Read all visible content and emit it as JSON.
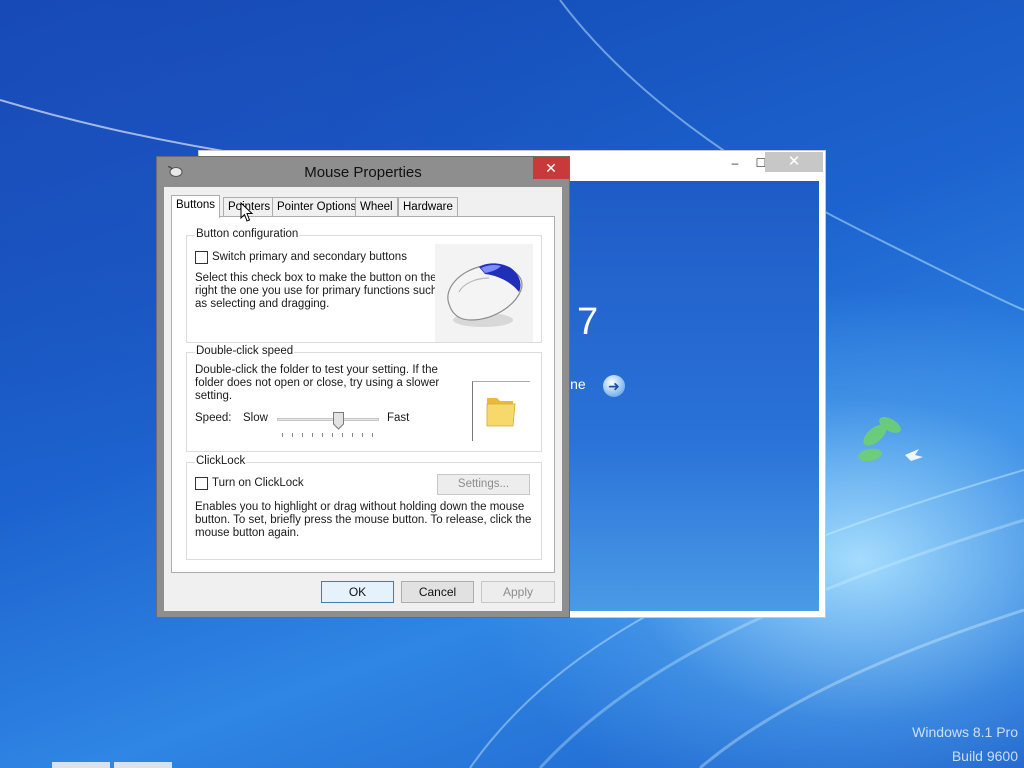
{
  "desktop": {
    "watermark_line1": "Windows 8.1 Pro",
    "watermark_line2": "Build 9600"
  },
  "background_window": {
    "minimize_glyph": "–",
    "maximize_glyph": "☐",
    "close_glyph": "✕",
    "partial_heading": "7",
    "partial_link": "ine"
  },
  "dialog": {
    "title": "Mouse Properties",
    "close_glyph": "✕",
    "tabs": [
      {
        "label": "Buttons",
        "active": true
      },
      {
        "label": "Pointers",
        "active": false
      },
      {
        "label": "Pointer Options",
        "active": false
      },
      {
        "label": "Wheel",
        "active": false
      },
      {
        "label": "Hardware",
        "active": false
      }
    ],
    "button_configuration": {
      "legend": "Button configuration",
      "checkbox_label": "Switch primary and secondary buttons",
      "checked": false,
      "description_lines": [
        "Select this check box to make the button on the",
        "right the one you use for primary functions such",
        "as selecting and dragging."
      ]
    },
    "double_click_speed": {
      "legend": "Double-click speed",
      "description_lines": [
        "Double-click the folder to test your setting. If the",
        "folder does not open or close, try using a slower",
        "setting."
      ],
      "speed_label": "Speed:",
      "slow_label": "Slow",
      "fast_label": "Fast",
      "slider_value_fraction": 0.6
    },
    "clicklock": {
      "legend": "ClickLock",
      "checkbox_label": "Turn on ClickLock",
      "checked": false,
      "settings_button": "Settings...",
      "description_lines": [
        "Enables you to highlight or drag without holding down the mouse",
        "button. To set, briefly press the mouse button. To release, click the",
        "mouse button again."
      ]
    },
    "buttons": {
      "ok": "OK",
      "cancel": "Cancel",
      "apply": "Apply"
    }
  },
  "colors": {
    "close_red": "#c7393b",
    "dialog_frame": "#8e8e8e",
    "desktop_blue": "#1d63cf"
  }
}
